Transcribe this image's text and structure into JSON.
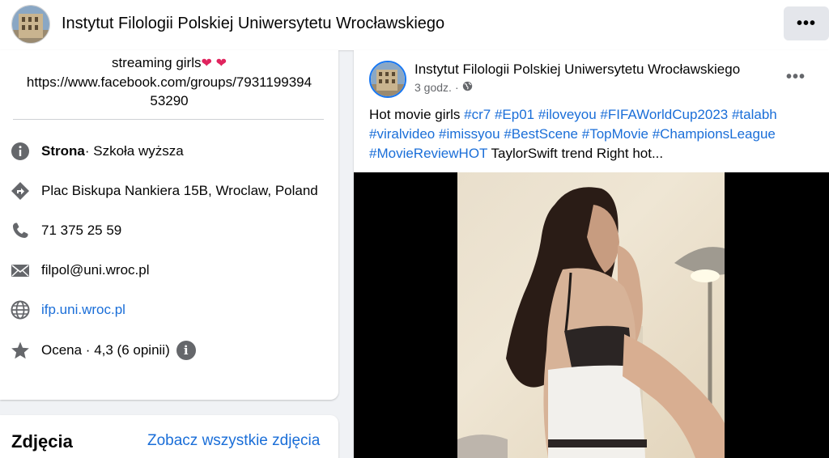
{
  "header": {
    "title": "Instytut Filologii Polskiej Uniwersytetu Wrocławskiego",
    "more_label": "•••"
  },
  "intro": {
    "bio_line1": "streaming girls",
    "bio_line2": "https://www.facebook.com/groups/7931199394",
    "bio_line3": "53290",
    "heart": "❤",
    "category_label": "Strona",
    "category_value": " · Szkoła wyższa",
    "address": "Plac Biskupa Nankiera 15B, Wroclaw, Poland",
    "phone": "71 375 25 59",
    "email": "filpol@uni.wroc.pl",
    "website": "ifp.uni.wroc.pl",
    "rating": "Ocena · 4,3 (6 opinii)",
    "info_icon_glyph": "i"
  },
  "photos": {
    "title": "Zdjęcia",
    "see_all": "Zobacz wszystkie zdjęcia"
  },
  "post": {
    "author": "Instytut Filologii Polskiej Uniwersytetu Wrocławskiego",
    "time": "3 godz.",
    "dot": "·",
    "more_label": "•••",
    "text_start": "Hot movie  girls ",
    "tags_line1": [
      "#cr7",
      "#Ep01",
      "#iloveyou",
      "#FIFAWorldCup2023",
      "#talabh"
    ],
    "tags_line2": [
      "#viralvideo",
      "#imissyou",
      "#BestScene",
      "#TopMovie",
      "#ChampionsLeague"
    ],
    "tag_last": "#MovieReviewHOT",
    "text_end": " TaylorSwift trend Right hot..."
  },
  "colors": {
    "link": "#1a6ed8",
    "icon_gray": "#65676b",
    "background": "#f0f2f5"
  }
}
